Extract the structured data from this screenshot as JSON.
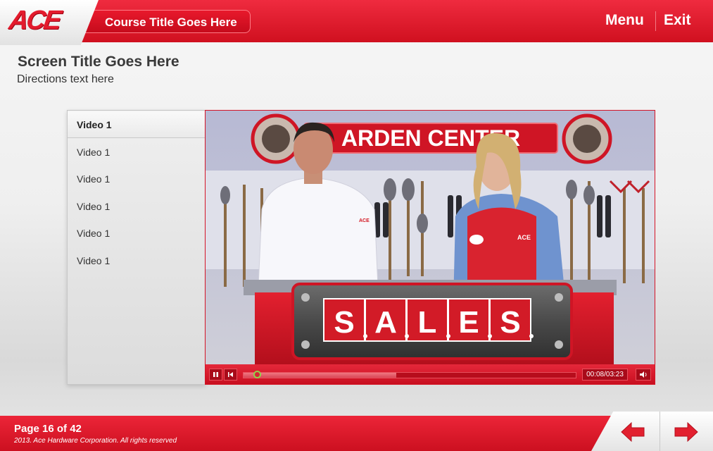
{
  "header": {
    "logo_text": "ACE",
    "course_title": "Course Title Goes Here",
    "menu_label": "Menu",
    "exit_label": "Exit"
  },
  "main": {
    "screen_title": "Screen Title Goes Here",
    "directions": "Directions text here"
  },
  "video_list": {
    "items": [
      {
        "label": "Video 1",
        "active": true
      },
      {
        "label": "Video 1",
        "active": false
      },
      {
        "label": "Video 1",
        "active": false
      },
      {
        "label": "Video 1",
        "active": false
      },
      {
        "label": "Video 1",
        "active": false
      },
      {
        "label": "Video 1",
        "active": false
      }
    ]
  },
  "player": {
    "scene_sign_text": "ARDEN CENTER",
    "scene_letters": [
      "S",
      "A",
      "L",
      "E",
      "S"
    ],
    "scene_shirt_logo": "ACE",
    "time_display": "00:08/03:23",
    "progress_fraction": 0.04,
    "buffered_fraction": 0.46,
    "controls": [
      "pause-icon",
      "skip-back-icon",
      "volume-icon"
    ]
  },
  "footer": {
    "page_label": "Page 16 of 42",
    "copyright": "2013. Ace Hardware Corporation. All rights reserved",
    "nav": [
      "back-arrow-icon",
      "next-arrow-icon"
    ]
  },
  "colors": {
    "brand_red": "#e31b2d",
    "dark_red": "#c80f20",
    "text_dark": "#3a3a3a",
    "progress_green": "#8fd34a"
  }
}
